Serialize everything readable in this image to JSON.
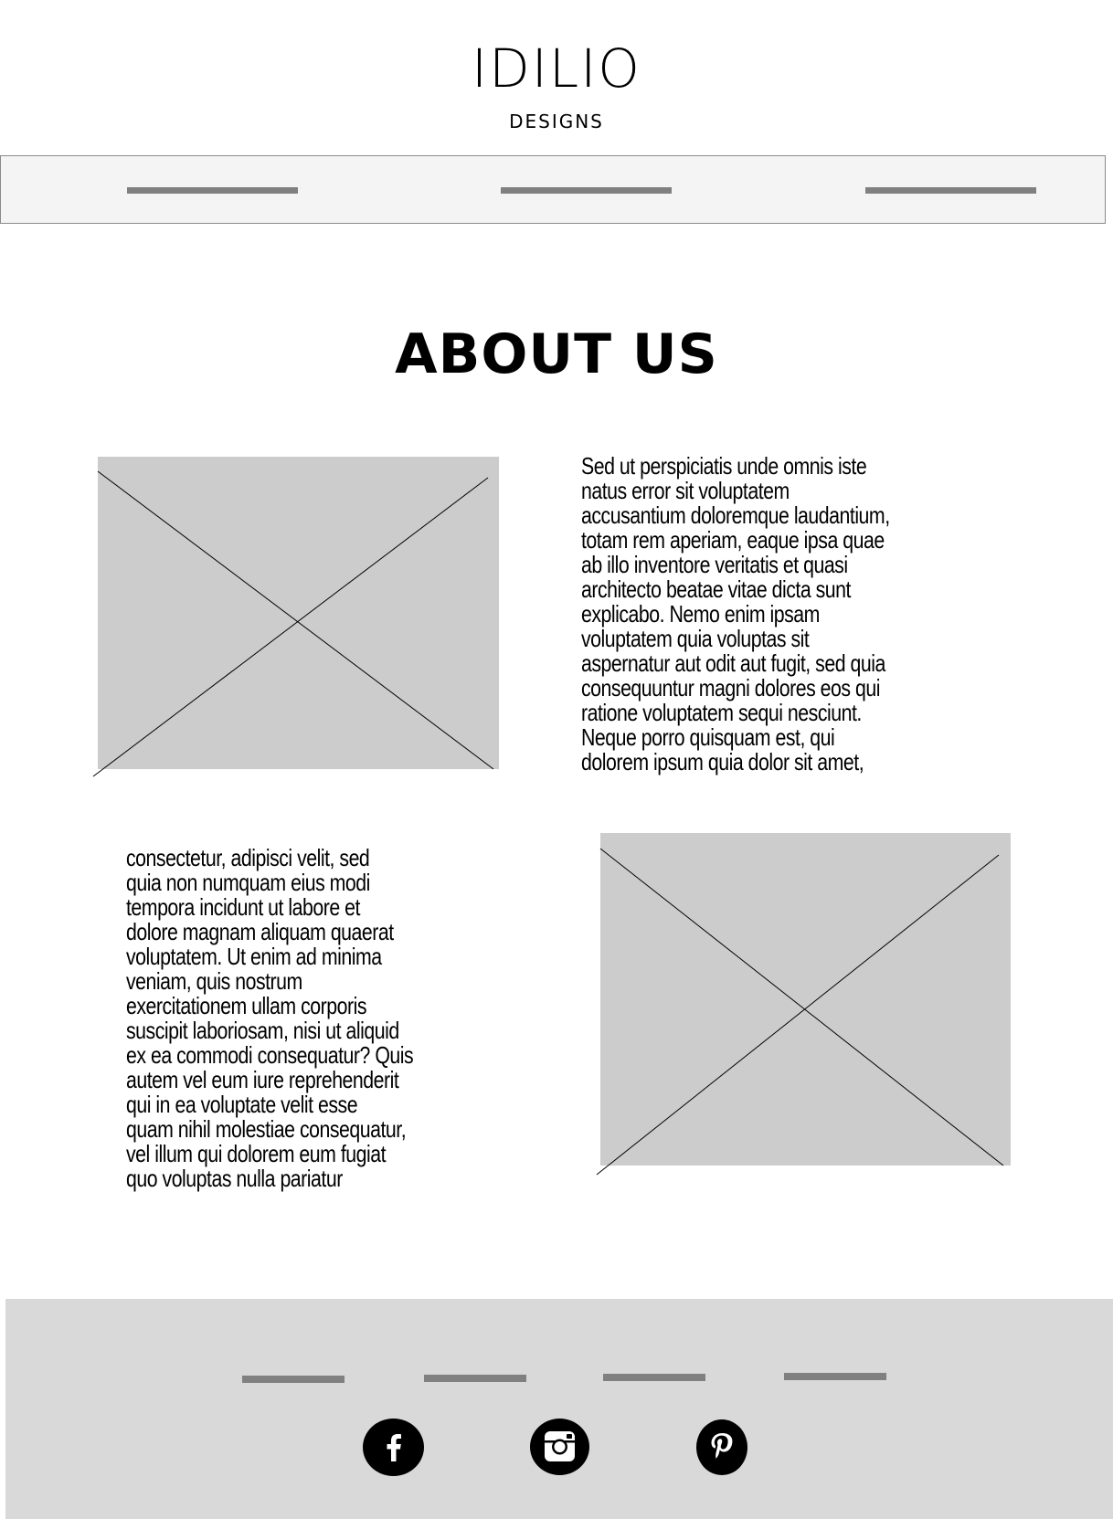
{
  "header": {
    "brand": "IDILIO",
    "tagline": "DESIGNS"
  },
  "nav": {
    "items": [
      "",
      "",
      ""
    ]
  },
  "main": {
    "title": "ABOUT US",
    "paragraph_1": "Sed ut perspiciatis unde omnis iste\nnatus error sit voluptatem\naccusantium doloremque laudantium,\ntotam rem aperiam, eaque ipsa quae\nab illo inventore veritatis et quasi\narchitecto beatae vitae dicta sunt\nexplicabo. Nemo enim ipsam\nvoluptatem quia voluptas sit\naspernatur aut odit aut fugit, sed quia\nconsequuntur magni dolores eos qui\nratione voluptatem sequi nesciunt.\nNeque porro quisquam est, qui\ndolorem ipsum quia dolor sit amet,",
    "paragraph_2": "consectetur, adipisci velit, sed\nquia non numquam eius modi\ntempora incidunt ut labore et\ndolore magnam aliquam quaerat\nvoluptatem. Ut enim ad minima\nveniam, quis nostrum\nexercitationem ullam corporis\nsuscipit laboriosam, nisi ut aliquid\nex ea commodi consequatur? Quis\nautem vel eum iure reprehenderit\nqui in ea voluptate velit esse\nquam nihil molestiae consequatur,\nvel illum qui dolorem eum fugiat\nquo voluptas nulla pariatur"
  },
  "footer": {
    "links": [
      "",
      "",
      "",
      ""
    ],
    "social": [
      {
        "icon": "facebook-icon"
      },
      {
        "icon": "instagram-icon"
      },
      {
        "icon": "pinterest-icon"
      }
    ]
  },
  "colors": {
    "nav_background": "#f4f4f4",
    "placeholder": "#cccccc",
    "footer_background": "#d9d9d9",
    "placeholder_bar": "#808080"
  }
}
